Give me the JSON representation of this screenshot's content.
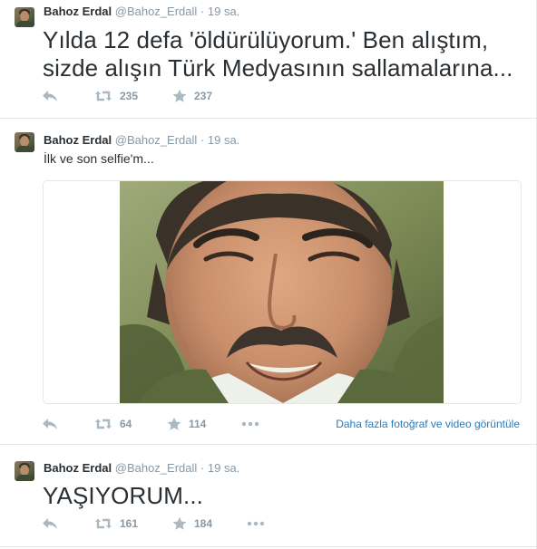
{
  "tweets": [
    {
      "fullname": "Bahoz Erdal",
      "username": "@Bahoz_Erdall",
      "dot": "·",
      "time": "19 sa.",
      "text_lines": [
        "Yılda 12 defa 'öldürülüyorum.' Ben alıştım,",
        "sizde alışın Türk Medyasının sallamalarına..."
      ],
      "retweets": "235",
      "favorites": "237"
    },
    {
      "fullname": "Bahoz Erdal",
      "username": "@Bahoz_Erdall",
      "dot": "·",
      "time": "19 sa.",
      "text": "İlk ve son selfie'm...",
      "retweets": "64",
      "favorites": "114",
      "more_link": "Daha fazla fotoğraf ve video görüntüle"
    },
    {
      "fullname": "Bahoz Erdal",
      "username": "@Bahoz_Erdall",
      "dot": "·",
      "time": "19 sa.",
      "text": "YAŞIYORUM...",
      "retweets": "161",
      "favorites": "184"
    }
  ],
  "icons": {
    "reply": "reply-icon",
    "retweet": "retweet-icon",
    "favorite": "star-icon",
    "more": "more-dots-icon"
  },
  "colors": {
    "text": "#292f33",
    "meta": "#8899a6",
    "icon": "#aab8c2",
    "link": "#2b7bb9",
    "border": "#e1e8ed"
  }
}
